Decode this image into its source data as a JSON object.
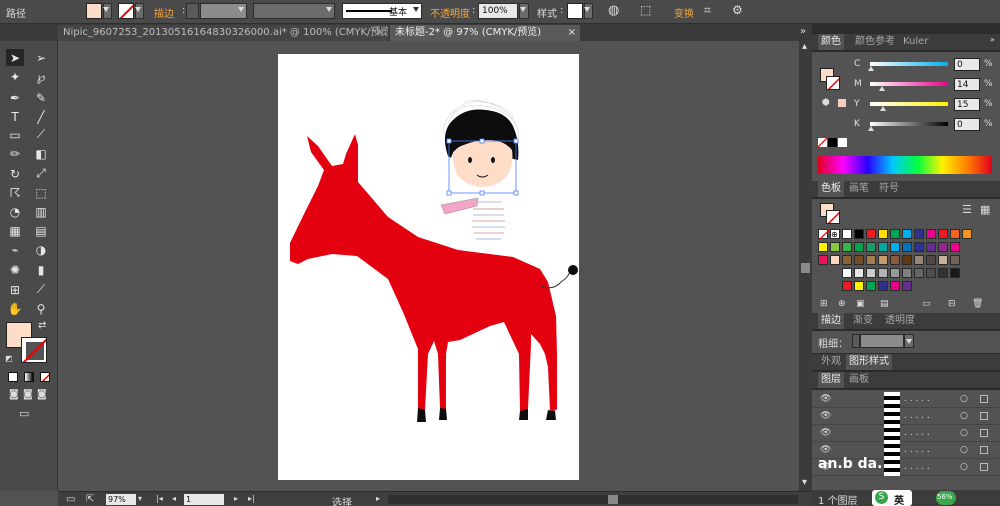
{
  "control_bar": {
    "object_type": "路径",
    "stroke_label": "描边",
    "stroke_profile": "基本",
    "opacity_label": "不透明度",
    "opacity_value": "100%",
    "style_label": "样式",
    "transform_label": "变换",
    "fill_color": "#fddcc8"
  },
  "tabs": [
    {
      "label": "Nipic_9607253_20130516164830326000.ai* @ 100% (CMYK/预览)",
      "active": false
    },
    {
      "label": "未标题-2* @ 97% (CMYK/预览)",
      "active": true
    }
  ],
  "tabs_close": "×",
  "color_panel": {
    "tabs": [
      "颜色",
      "颜色参考",
      "Kuler"
    ],
    "sliders": [
      {
        "letter": "C",
        "value": "0",
        "level": 0,
        "gradient": "linear-gradient(90deg,#fff,#00aeef)"
      },
      {
        "letter": "M",
        "value": "14",
        "level": 14,
        "gradient": "linear-gradient(90deg,#fff,#ec008c)"
      },
      {
        "letter": "Y",
        "value": "15",
        "level": 15,
        "gradient": "linear-gradient(90deg,#fff,#fff200)"
      },
      {
        "letter": "K",
        "value": "0",
        "level": 0,
        "gradient": "linear-gradient(90deg,#fff,#000)"
      }
    ],
    "percent": "%"
  },
  "swatches_panel": {
    "tabs": [
      "色板",
      "画笔",
      "符号"
    ],
    "row1": [
      "#ffffff",
      "#000000",
      "#ed1c24",
      "#ffde00",
      "#00a651",
      "#00aeef",
      "#2e3192",
      "#ec008c",
      "#ed1c24",
      "#f26522",
      "#f7941d"
    ],
    "row2": [
      "#fff200",
      "#8dc63f",
      "#39b54a",
      "#00a651",
      "#1b9a6a",
      "#00a99d",
      "#00aeef",
      "#0072bc",
      "#2e3192",
      "#662d91",
      "#92278f",
      "#ec008c"
    ],
    "row3": [
      "#ed145b",
      "#f9d6c1",
      "#8c6239",
      "#754c24",
      "#a67c52",
      "#c69c6d",
      "#8a5a3c",
      "#603913",
      "#998675",
      "#534741",
      "#c7b299",
      "#736357"
    ],
    "row4": [
      "#ffffff",
      "#e6e6e6",
      "#cccccc",
      "#b3b3b3",
      "#999999",
      "#808080",
      "#666666",
      "#4d4d4d",
      "#333333",
      "#1a1a1a"
    ],
    "row5": [
      "#ed1c24",
      "#fff200",
      "#00a651",
      "#2e3192",
      "#ec008c",
      "#662d91"
    ]
  },
  "stroke_panel": {
    "tabs": [
      "描边",
      "渐变",
      "透明度"
    ],
    "weight_label": "粗细："
  },
  "appearance_panel": {
    "tabs": [
      "外观",
      "图形样式"
    ]
  },
  "layers_panel": {
    "tabs": [
      "图层",
      "画板"
    ],
    "rows": [
      ". . . . .",
      ". . . . .",
      ". . . . .",
      ". . . . .",
      ". . . . ."
    ],
    "footer": "1 个图层"
  },
  "status_bar": {
    "zoom": "97%",
    "artboard_number": "1",
    "status_text": "选择"
  },
  "watermark": {
    "text": "an.b  da.",
    "badge_text": "英",
    "badge_icon": "S",
    "percent": "56%"
  },
  "artwork": {
    "donkey_color": "#e3000f",
    "face_color": "#fddcc8",
    "hair_color": "#0d0d0d"
  }
}
